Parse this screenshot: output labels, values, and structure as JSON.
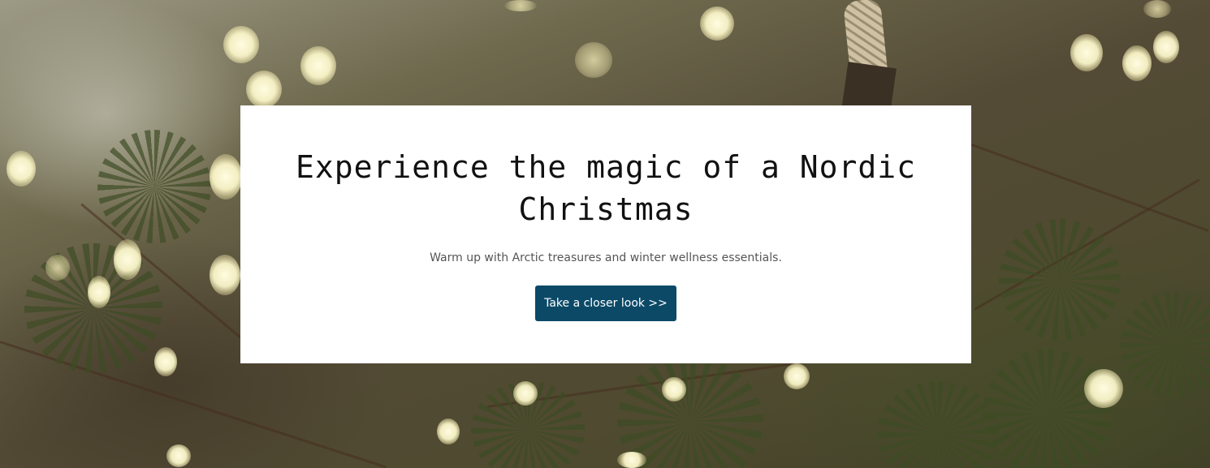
{
  "hero": {
    "title": "Experience the magic of a Nordic Christmas",
    "subtitle": "Warm up with Arctic treasures and winter wellness essentials.",
    "cta_label": "Take a closer look >>"
  },
  "colors": {
    "card_background": "#ffffff",
    "cta_background": "#0b4967",
    "cta_text": "#ffffff",
    "title_text": "#111111",
    "subtitle_text": "#555555"
  }
}
